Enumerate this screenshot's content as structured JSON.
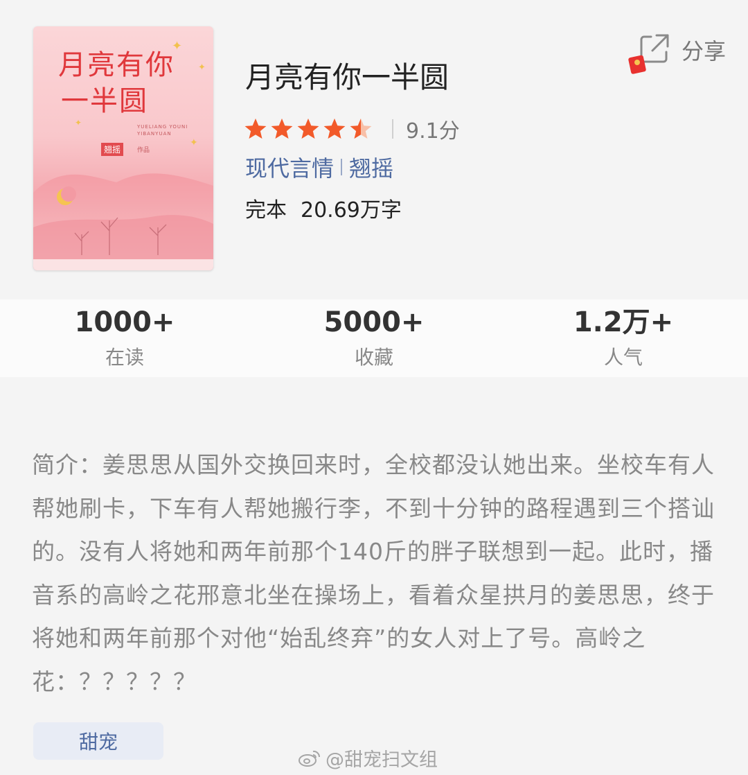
{
  "book": {
    "title": "月亮有你一半圆",
    "rating_score": "9.1分",
    "rating_value": 4.5,
    "rating_max": 5,
    "category": "现代言情",
    "author": "翘摇",
    "status": "完本",
    "word_count": "20.69万字"
  },
  "cover": {
    "title_line1": "月亮有你",
    "title_line2": "一半圆",
    "pinyin": "YUELIANG YOUNI YIBANYUAN",
    "author_stamp": "翘摇",
    "author_suffix": "作品"
  },
  "share": {
    "label": "分享"
  },
  "stats": [
    {
      "value": "1000+",
      "label": "在读"
    },
    {
      "value": "5000+",
      "label": "收藏"
    },
    {
      "value": "1.2万+",
      "label": "人气"
    }
  ],
  "intro": {
    "text": "简介：姜思思从国外交换回来时，全校都没认她出来。坐校车有人帮她刷卡，下车有人帮她搬行李，不到十分钟的路程遇到三个搭讪的。没有人将她和两年前那个140斤的胖子联想到一起。此时，播音系的高岭之花邢意北坐在操场上，看着众星拱月的姜思思，终于将她和两年前那个对他“始乱终弃”的女人对上了号。高岭之花：？？？？？"
  },
  "tags": [
    "甜宠"
  ],
  "watermark": "@甜宠扫文组",
  "colors": {
    "star": "#f25a2a",
    "link": "#4e6aa1",
    "background": "#f4f4f4"
  }
}
